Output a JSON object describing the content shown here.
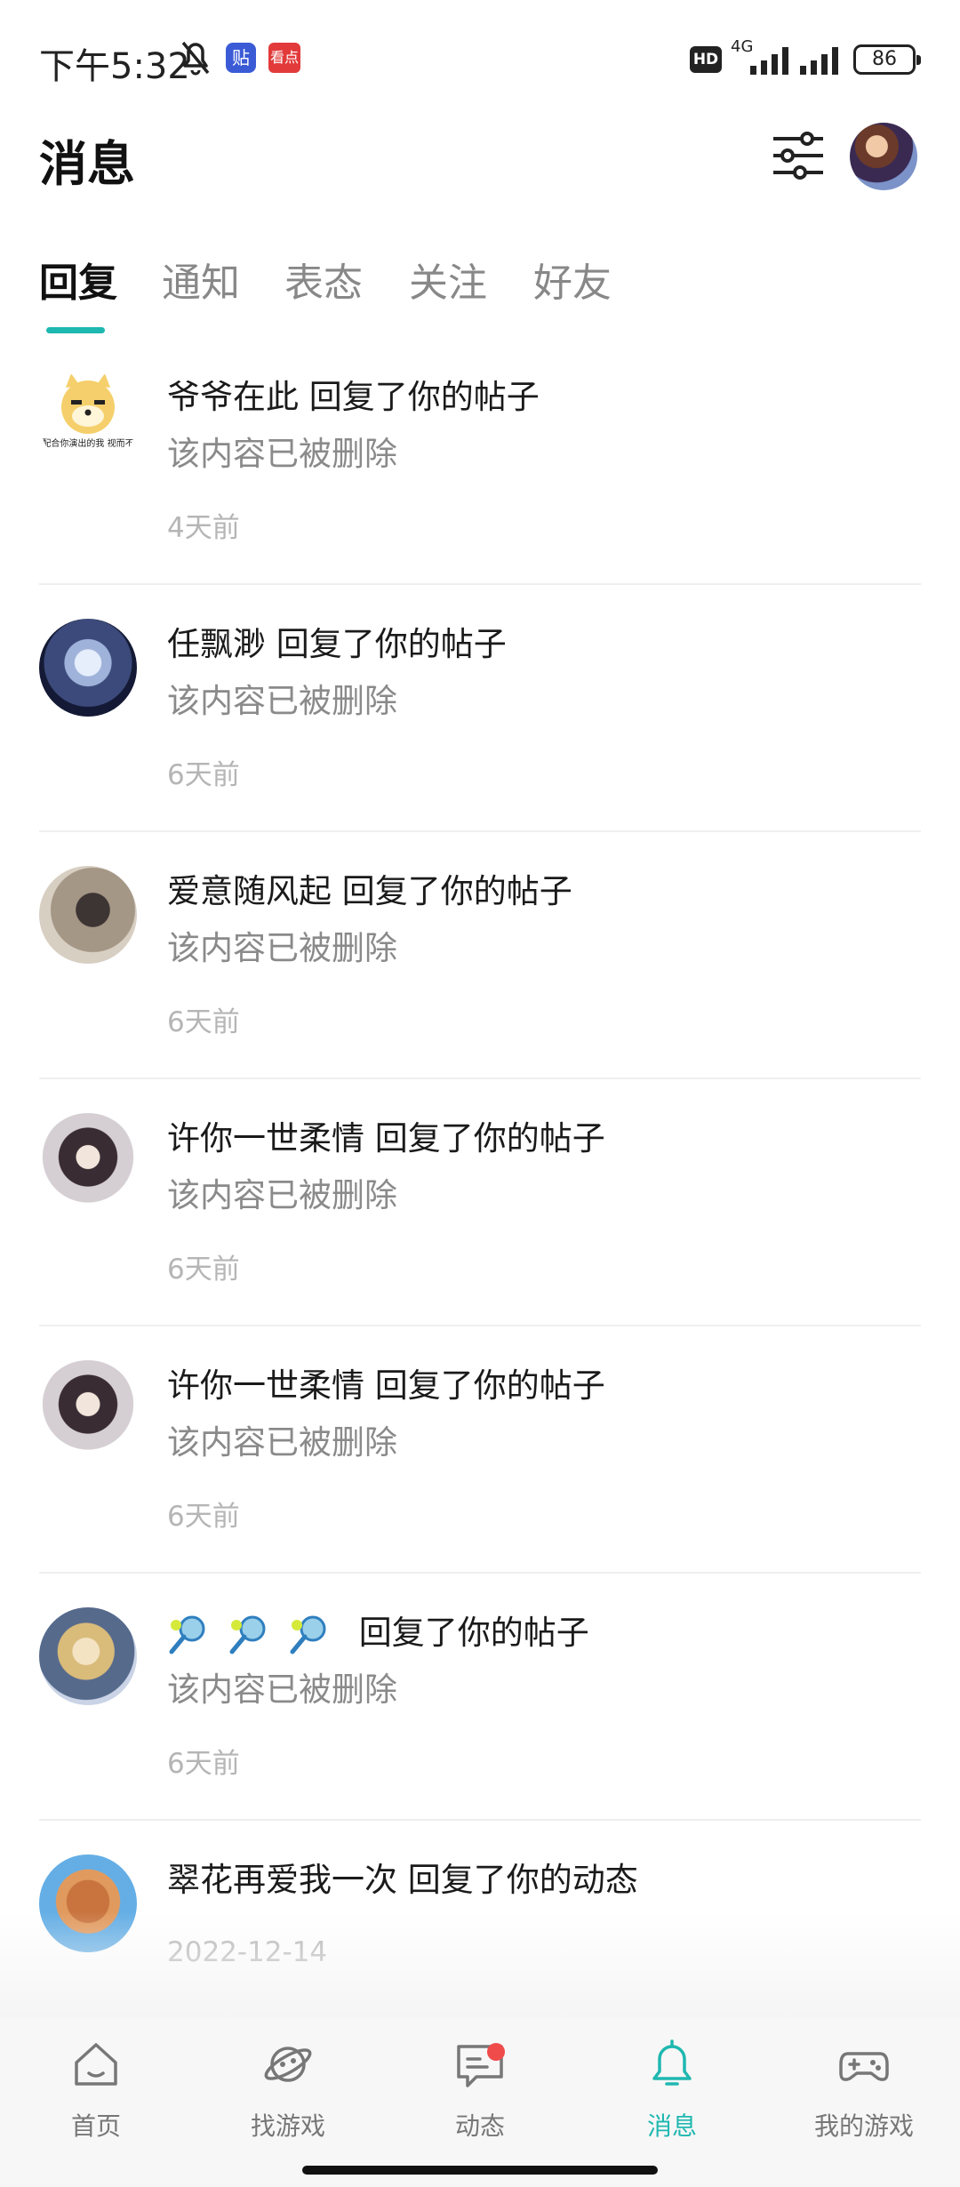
{
  "status_bar": {
    "time": "下午5:32",
    "app1": "贴",
    "app2": "看点",
    "hd": "HD",
    "network": "4G",
    "battery": "86"
  },
  "header": {
    "title": "消息"
  },
  "tabs": [
    {
      "label": "回复",
      "active": true
    },
    {
      "label": "通知"
    },
    {
      "label": "表态"
    },
    {
      "label": "关注"
    },
    {
      "label": "好友"
    }
  ],
  "messages": [
    {
      "name": "爷爷在此",
      "action": "回复了你的帖子",
      "content": "该内容已被删除",
      "time": "4天前",
      "avatar_text": "该配合你演出的我 视而不见"
    },
    {
      "name": "任飘渺",
      "action": "回复了你的帖子",
      "content": "该内容已被删除",
      "time": "6天前"
    },
    {
      "name": "爱意随风起",
      "action": "回复了你的帖子",
      "content": "该内容已被删除",
      "time": "6天前"
    },
    {
      "name": "许你一世柔情",
      "action": "回复了你的帖子",
      "content": "该内容已被删除",
      "time": "6天前"
    },
    {
      "name": "许你一世柔情",
      "action": "回复了你的帖子",
      "content": "该内容已被删除",
      "time": "6天前"
    },
    {
      "name": "",
      "action": "回复了你的帖子",
      "content": "该内容已被删除",
      "time": "6天前",
      "name_icons": [
        "tennis-racket",
        "tennis-racket",
        "tennis-racket"
      ]
    },
    {
      "name": "翠花再爱我一次",
      "action": "回复了你的动态",
      "content": "",
      "time": "2022-12-14"
    }
  ],
  "bottom_nav": [
    {
      "label": "首页",
      "icon": "home-icon"
    },
    {
      "label": "找游戏",
      "icon": "planet-icon"
    },
    {
      "label": "动态",
      "icon": "chat-icon",
      "badge": true
    },
    {
      "label": "消息",
      "icon": "bell-icon",
      "active": true
    },
    {
      "label": "我的游戏",
      "icon": "gamepad-icon"
    }
  ],
  "colors": {
    "accent": "#1fb8b0",
    "badge": "#ef4b4b"
  }
}
